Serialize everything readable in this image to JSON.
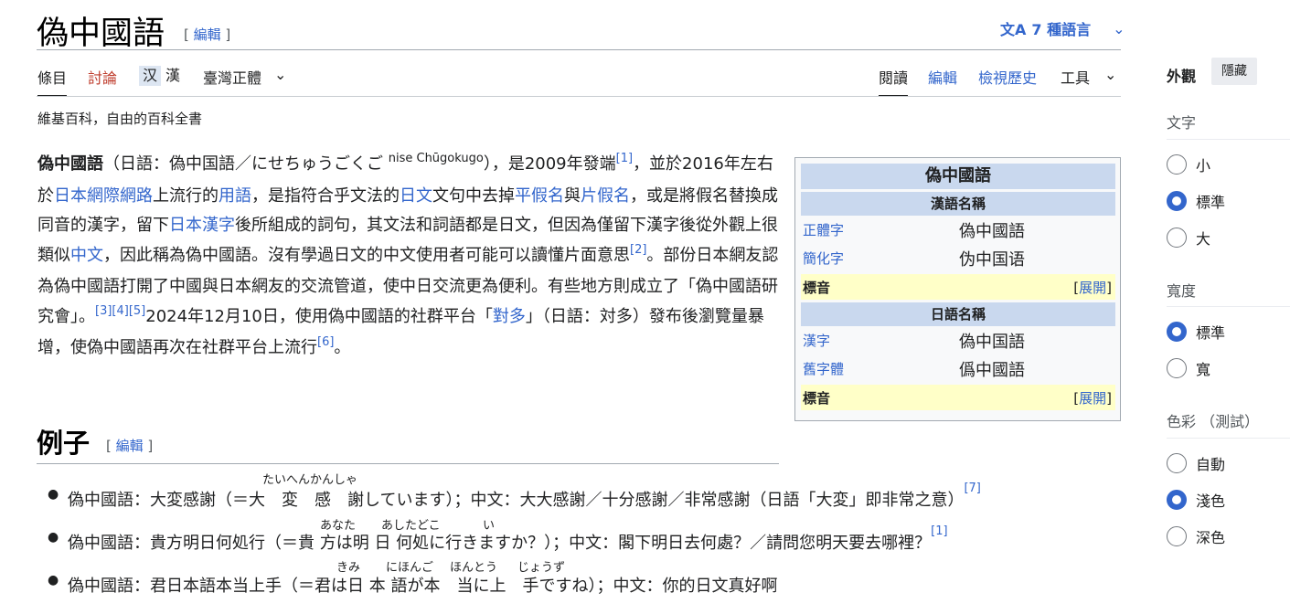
{
  "title": "偽中國語",
  "edit": "編輯",
  "languages": {
    "icon": "文A",
    "label": "7 種語言",
    "chevron": "⌄"
  },
  "tabs": {
    "article": "條目",
    "talk": "討論",
    "variant_simp": "汉",
    "variant_trad": "漢",
    "variant_current": "臺灣正體",
    "read": "閱讀",
    "edit": "編輯",
    "history": "檢視歷史",
    "tools": "工具"
  },
  "tagline": "維基百科，自由的百科全書",
  "intro": {
    "term": "偽中國語",
    "p1": "（日語：偽中国語／にせちゅうごくご ",
    "romaji": "nise Chūgokugo",
    "p2": "），是2009年發端",
    "ref1": "[1]",
    "p3": "，並於2016年左右於",
    "l_net": "日本網際網路",
    "p4": "上流行的",
    "l_yongyu": "用語",
    "p5": "，是指符合乎文法的",
    "l_riwen": "日文",
    "p6": "文句中去掉",
    "l_hira": "平假名",
    "p7": "與",
    "l_kata": "片假名",
    "p8": "，或是將假名替換成同音的漢字，留下",
    "l_kanji": "日本漢字",
    "p9": "後所組成的詞句，其文法和詞語都是日文，但因為僅留下漢字後從外觀上很類似",
    "l_zhongwen": "中文",
    "p10": "，因此稱為偽中國語。沒有學過日文的中文使用者可能可以讀懂片面意思",
    "ref2": "[2]",
    "p11": "。部份日本網友認為偽中國語打開了中國與日本網友的交流管道，使中日交流更為便利。有些地方則成立了「偽中國語研究會」。",
    "ref345": "[3][4][5]",
    "p12": "2024年12月10日，使用偽中國語的社群平台「",
    "l_duiduo": "對多",
    "p13": "」（日語：対多）發布後瀏覽量暴增，使偽中國語再次在社群平台上流行",
    "ref6": "[6]",
    "p14": "。"
  },
  "infobox": {
    "title": "偽中國語",
    "section1": "漢語名稱",
    "rows1": [
      {
        "k": "正體字",
        "v": "偽中國語"
      },
      {
        "k": "簡化字",
        "v": "伪中国语"
      }
    ],
    "pron_label": "標音",
    "expand": "展開",
    "section2": "日語名稱",
    "rows2": [
      {
        "k": "漢字",
        "v": "偽中国語"
      },
      {
        "k": "舊字體",
        "v": "僞中國語"
      }
    ]
  },
  "section": {
    "title": "例子",
    "edit": "編輯"
  },
  "examples": [
    {
      "text": "偽中國語：大変感謝（＝大　変　感　謝しています）；中文：大大感謝／十分感謝／非常感謝（日語「大変」即非常之意）",
      "ref": "[7]",
      "ruby": "たいへんかんしゃ"
    },
    {
      "text": "偽中國語：貴方明日何処行（＝貴 方は明 日 何処に行きますか？）；中文：閣下明日去何處？／請問您明天要去哪裡？",
      "ref": "[1]",
      "ruby_a": "あなた",
      "ruby_b": "あしたどこ",
      "ruby_c": "い"
    },
    {
      "text": "偽中國語：君日本語本当上手（＝君は日 本 語が本　当に上　手ですね）；中文：你的日文真好啊",
      "ref": "",
      "ruby_a": "きみ",
      "ruby_b": "にほんご",
      "ruby_c": "ほんとう",
      "ruby_d": "じょうず"
    }
  ],
  "sidebar": {
    "appearance": "外觀",
    "hide": "隱藏",
    "text_head": "文字",
    "text_opts": [
      "小",
      "標準",
      "大"
    ],
    "text_selected": "標準",
    "width_head": "寬度",
    "width_opts": [
      "標準",
      "寬"
    ],
    "width_selected": "標準",
    "color_head": "色彩 （測試）",
    "color_opts": [
      "自動",
      "淺色",
      "深色"
    ],
    "color_selected": "淺色"
  }
}
